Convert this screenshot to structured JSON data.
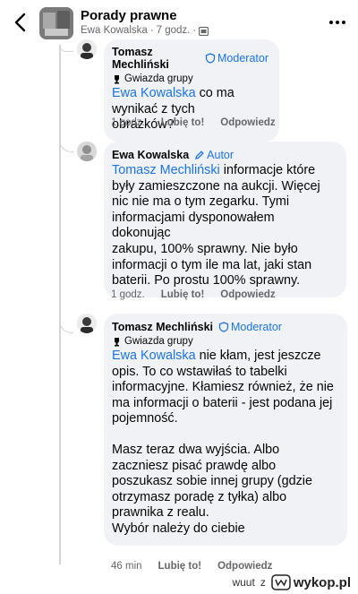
{
  "header": {
    "group_name": "Porady prawne",
    "author": "Ewa Kowalska",
    "time": "7 godz.",
    "separator": "·"
  },
  "comments": [
    {
      "author": "Tomasz Mechliński",
      "role": "Moderator",
      "badge": "Gwiazda grupy",
      "mention": "Ewa Kowalska",
      "text": " co ma wynikać z tych\nobrazków?",
      "time": "1 godz.",
      "like": "Lubię to!",
      "reply": "Odpowiedz"
    },
    {
      "author": "Ewa Kowalska",
      "role": "Autor",
      "mention": "Tomasz Mechliński",
      "text": " informacje które\nbyły zamieszczone na aukcji.  Więcej\nnic nie ma o tym zegarku. Tymi\ninformacjami dysponowałem dokonując\nzakupu, 100% sprawny. Nie było\ninformacji o tym ile ma lat, jaki stan\nbaterii. Po prostu 100% sprawny.",
      "time": "1 godz.",
      "like": "Lubię to!",
      "reply": "Odpowiedz"
    },
    {
      "author": "Tomasz Mechliński",
      "role": "Moderator",
      "badge": "Gwiazda grupy",
      "mention": "Ewa Kowalska",
      "text": " nie kłam, jest jeszcze\nopis. To co wstawiłaś to tabelki\ninformacyjne. Kłamiesz również, że nie\nma informacji o baterii - jest podana jej\npojemność.",
      "text2": "Masz teraz dwa wyjścia. Albo\nzaczniesz pisać prawdę albo\nposzukasz sobie innej grupy (gdzie\notrzymasz poradę z tyłka) albo\nprawnika z realu.\nWybór należy do ciebie",
      "time": "46 min",
      "like": "Lubię to!",
      "reply": "Odpowiedz"
    }
  ],
  "watermark": {
    "user": "wuut",
    "suffix": "z",
    "site": "wykop.pl"
  }
}
